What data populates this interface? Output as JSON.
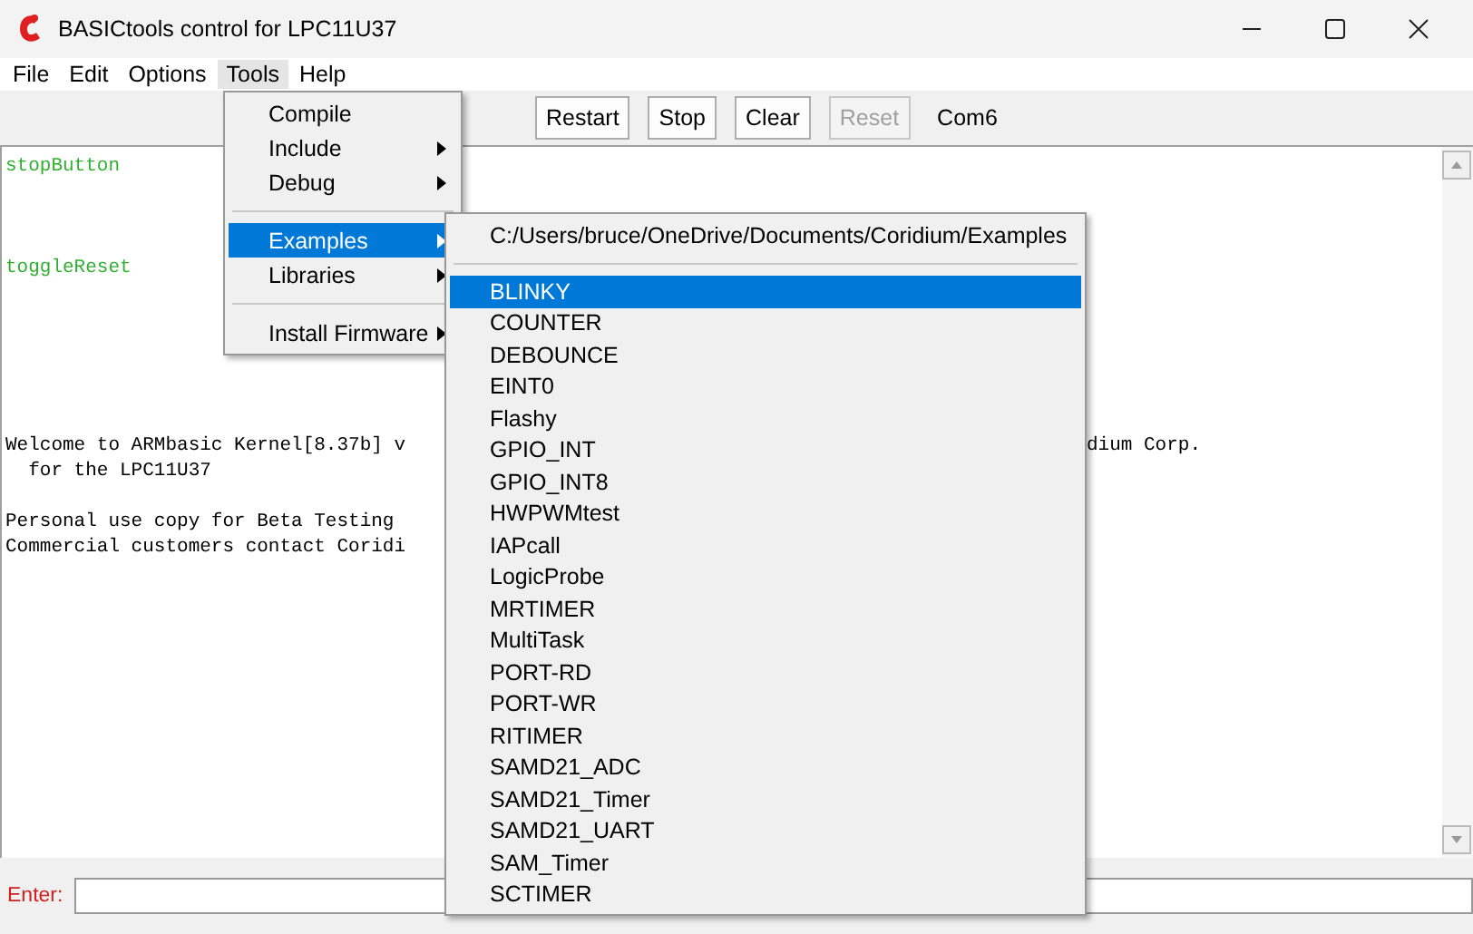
{
  "window": {
    "title": "BASICtools control for LPC11U37"
  },
  "menu_bar": [
    {
      "label": "File",
      "selected": false
    },
    {
      "label": "Edit",
      "selected": false
    },
    {
      "label": "Options",
      "selected": false
    },
    {
      "label": "Tools",
      "selected": true
    },
    {
      "label": "Help",
      "selected": false
    }
  ],
  "toolbar": {
    "buttons": [
      {
        "label": "Restart",
        "disabled": false
      },
      {
        "label": "Stop",
        "disabled": false
      },
      {
        "label": "Clear",
        "disabled": false
      },
      {
        "label": "Reset",
        "disabled": true
      }
    ],
    "port": "Com6"
  },
  "console": {
    "groups": [
      [
        {
          "text": "stopButton",
          "kind": "event"
        }
      ],
      [
        {
          "text": "toggleReset",
          "kind": "event"
        }
      ],
      [
        {
          "text": "Welcome to ARMbasic Kernel[8.37b] v",
          "kind": "output",
          "tail": "dium Corp."
        },
        {
          "text": "  for the LPC11U37",
          "kind": "output"
        }
      ],
      [
        {
          "text": "Personal use copy for Beta Testing",
          "kind": "output"
        },
        {
          "text": "Commercial customers contact Coridi",
          "kind": "output"
        }
      ]
    ]
  },
  "input_bar": {
    "label": "Enter:"
  },
  "tools_menu": [
    {
      "kind": "item",
      "label": "Compile",
      "submenu": false,
      "selected": false
    },
    {
      "kind": "item",
      "label": "Include",
      "submenu": true,
      "selected": false
    },
    {
      "kind": "item",
      "label": "Debug",
      "submenu": true,
      "selected": false
    },
    {
      "kind": "separator"
    },
    {
      "kind": "item",
      "label": "Examples",
      "submenu": true,
      "selected": true
    },
    {
      "kind": "item",
      "label": "Libraries",
      "submenu": true,
      "selected": false
    },
    {
      "kind": "separator"
    },
    {
      "kind": "item",
      "label": "Install Firmware",
      "submenu": true,
      "selected": false
    }
  ],
  "examples_menu": {
    "path": "C:/Users/bruce/OneDrive/Documents/Coridium/Examples",
    "items": [
      {
        "label": "BLINKY",
        "selected": true
      },
      {
        "label": "COUNTER",
        "selected": false
      },
      {
        "label": "DEBOUNCE",
        "selected": false
      },
      {
        "label": "EINT0",
        "selected": false
      },
      {
        "label": "Flashy",
        "selected": false
      },
      {
        "label": "GPIO_INT",
        "selected": false
      },
      {
        "label": "GPIO_INT8",
        "selected": false
      },
      {
        "label": "HWPWMtest",
        "selected": false
      },
      {
        "label": "IAPcall",
        "selected": false
      },
      {
        "label": "LogicProbe",
        "selected": false
      },
      {
        "label": "MRTIMER",
        "selected": false
      },
      {
        "label": "MultiTask",
        "selected": false
      },
      {
        "label": "PORT-RD",
        "selected": false
      },
      {
        "label": "PORT-WR",
        "selected": false
      },
      {
        "label": "RITIMER",
        "selected": false
      },
      {
        "label": "SAMD21_ADC",
        "selected": false
      },
      {
        "label": "SAMD21_Timer",
        "selected": false
      },
      {
        "label": "SAMD21_UART",
        "selected": false
      },
      {
        "label": "SAM_Timer",
        "selected": false
      },
      {
        "label": "SCTIMER",
        "selected": false
      }
    ]
  }
}
